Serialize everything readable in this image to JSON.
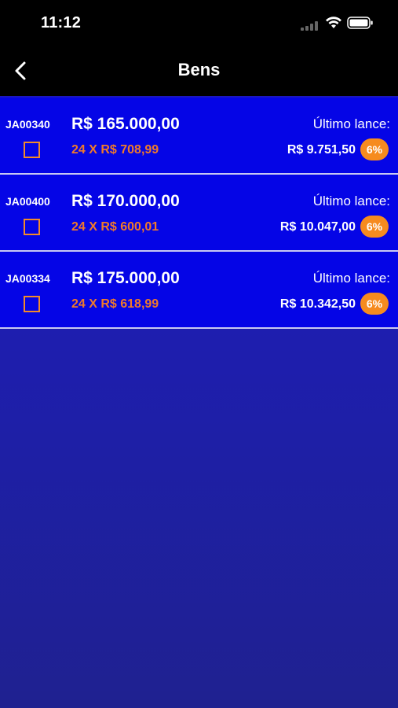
{
  "status_bar": {
    "time": "11:12",
    "icons": [
      "signal-icon",
      "wifi-icon",
      "battery-icon"
    ]
  },
  "navbar": {
    "title": "Bens",
    "back_icon": "chevron-left-icon"
  },
  "items": [
    {
      "code": "JA00340",
      "price": "R$ 165.000,00",
      "installment": "24 X R$ 708,99",
      "last_label": "Último lance:",
      "last_bid": "R$ 9.751,50",
      "percent": "6%"
    },
    {
      "code": "JA00400",
      "price": "R$ 170.000,00",
      "installment": "24 X R$ 600,01",
      "last_label": "Último lance:",
      "last_bid": "R$ 10.047,00",
      "percent": "6%"
    },
    {
      "code": "JA00334",
      "price": "R$ 175.000,00",
      "installment": "24 X R$ 618,99",
      "last_label": "Último lance:",
      "last_bid": "R$ 10.342,50",
      "percent": "6%"
    }
  ],
  "colors": {
    "item_background": "#0505e6",
    "accent_orange": "#f68b1f",
    "installment_text": "#f07a2a",
    "page_background": "#1e1eb0",
    "header_background": "#000000"
  }
}
